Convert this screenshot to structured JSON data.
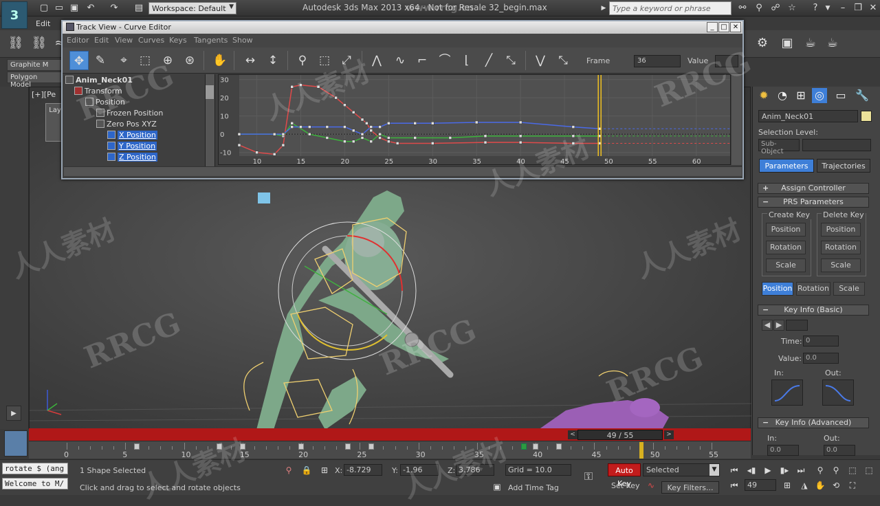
{
  "app": {
    "title": "Autodesk 3ds Max  2013 x64  - Not for Resale   32_begin.max",
    "workspace": "Workspace: Default",
    "search_placeholder": "Type a keyword or phrase",
    "edit_menu": "Edit"
  },
  "ribbon": {
    "tabs": [
      "Graphite M",
      "Polygon Model"
    ]
  },
  "viewport": {
    "label": "[+][Pe",
    "layer_label": "Lay"
  },
  "track_view": {
    "title": "Track View - Curve Editor",
    "menu": [
      "Editor",
      "Edit",
      "View",
      "Curves",
      "Keys",
      "Tangents",
      "Show"
    ],
    "frame_label": "Frame",
    "frame_value": "36",
    "value_label": "Value",
    "value_value": "",
    "tree": [
      {
        "label": "Anim_Neck01",
        "level": 0,
        "bold": true
      },
      {
        "label": "Transform",
        "level": 1
      },
      {
        "label": "Position",
        "level": 2
      },
      {
        "label": "Frozen Position",
        "level": 3
      },
      {
        "label": "Zero Pos XYZ",
        "level": 3
      },
      {
        "label": "X Position",
        "level": 4,
        "selected": true
      },
      {
        "label": "Y Position",
        "level": 4,
        "selected": true
      },
      {
        "label": "Z Position",
        "level": 4,
        "selected": true
      }
    ],
    "y_ticks": [
      "30",
      "20",
      "10",
      "0",
      "-10"
    ],
    "x_ticks": [
      "10",
      "15",
      "20",
      "25",
      "30",
      "35",
      "40",
      "45",
      "50",
      "55",
      "60"
    ],
    "colors": {
      "x": "#e04a4a",
      "y": "#3cb43c",
      "z": "#4a6ae8",
      "time": "#f0c020"
    }
  },
  "chart_data": {
    "type": "line",
    "title": "",
    "xlabel": "",
    "ylabel": "",
    "xlim": [
      8,
      64
    ],
    "ylim": [
      -12,
      31
    ],
    "current_frame": 49,
    "series": [
      {
        "name": "X Position",
        "color": "#e04a4a",
        "x": [
          8,
          10,
          12,
          13,
          14,
          15,
          17,
          19,
          20,
          21,
          22,
          22.5,
          23,
          24,
          25,
          26,
          30,
          36,
          40,
          46,
          49
        ],
        "y": [
          -6,
          -10,
          -11,
          -6,
          26,
          27,
          26,
          20,
          16,
          12,
          8,
          6,
          2,
          -2,
          -4,
          -5,
          -5,
          -4.5,
          -4.5,
          -5,
          -5
        ]
      },
      {
        "name": "Y Position",
        "color": "#3cb43c",
        "x": [
          8,
          12,
          13,
          14,
          16,
          18,
          20,
          21,
          22,
          23,
          24,
          25,
          28,
          32,
          36,
          40,
          46,
          49
        ],
        "y": [
          0,
          0,
          -1,
          6,
          0,
          -2,
          -4,
          -4,
          -2,
          -4,
          0,
          -2,
          -2,
          -2,
          -1,
          -1,
          -1,
          -1
        ]
      },
      {
        "name": "Z Position",
        "color": "#4a6ae8",
        "x": [
          8,
          12,
          13,
          14,
          15,
          16,
          18,
          20,
          21,
          22,
          23,
          24,
          25,
          28,
          30,
          35,
          40,
          46,
          49
        ],
        "y": [
          0,
          0,
          0,
          4,
          4,
          4,
          4,
          4,
          2,
          0,
          4,
          4,
          6,
          6,
          6,
          6.5,
          6.5,
          4,
          3
        ]
      }
    ]
  },
  "command_panel": {
    "object_name": "Anim_Neck01",
    "selection_level_label": "Selection Level:",
    "sub_object": "Sub-Object",
    "tab_parameters": "Parameters",
    "tab_trajectories": "Trajectories",
    "assign_controller": "Assign Controller",
    "prs_parameters": "PRS Parameters",
    "create_key": "Create Key",
    "delete_key": "Delete Key",
    "create_buttons": [
      "Position",
      "Rotation",
      "Scale"
    ],
    "delete_buttons": [
      "Position",
      "Rotation",
      "Scale"
    ],
    "mode_buttons": [
      "Position",
      "Rotation",
      "Scale"
    ],
    "key_info_basic": "Key Info (Basic)",
    "time_label": "Time:",
    "time_value": "0",
    "value_label": "Value:",
    "value_value": "0.0",
    "in_label": "In:",
    "out_label": "Out:",
    "key_info_advanced": "Key Info (Advanced)",
    "adv_in_label": "In:",
    "adv_out_label": "Out:",
    "adv_in_value": "0.0",
    "adv_out_value": "0.0"
  },
  "timeline": {
    "frame_display": "49 / 55",
    "ticks": [
      "0",
      "5",
      "10",
      "15",
      "20",
      "25",
      "30",
      "35",
      "40",
      "45",
      "50",
      "55"
    ],
    "keys": [
      6,
      13,
      15,
      20,
      24,
      26,
      40,
      42
    ]
  },
  "status": {
    "maxscript_1": "rotate $ (ang",
    "maxscript_2": "Welcome to M/",
    "selection": "1 Shape Selected",
    "prompt": "Click and drag to select and rotate objects",
    "x_label": "X:",
    "x_value": "-8.729",
    "y_label": "Y:",
    "y_value": "-1.96",
    "z_label": "Z:",
    "z_value": "3.786",
    "grid": "Grid = 10.0",
    "add_time_tag": "Add Time Tag",
    "auto_key": "Auto Key",
    "selected": "Selected",
    "set_key": "Set Key",
    "key_filters": "Key Filters...",
    "current_frame": "49"
  },
  "watermarks": [
    "RRCG",
    "人人素材",
    "www.rrcg.cn"
  ]
}
